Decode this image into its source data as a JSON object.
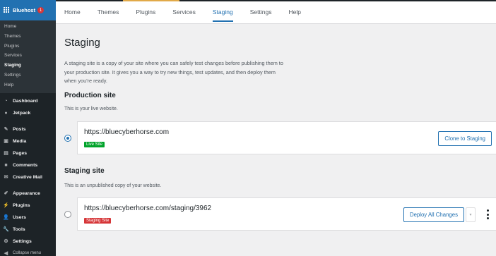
{
  "sidebar": {
    "brand": {
      "label": "Bluehost",
      "badge": "1"
    },
    "sub_items": [
      {
        "label": "Home",
        "active": false
      },
      {
        "label": "Themes",
        "active": false
      },
      {
        "label": "Plugins",
        "active": false
      },
      {
        "label": "Services",
        "active": false
      },
      {
        "label": "Staging",
        "active": true
      },
      {
        "label": "Settings",
        "active": false
      },
      {
        "label": "Help",
        "active": false
      }
    ],
    "items": [
      {
        "label": "Dashboard",
        "icon": "dashboard-icon"
      },
      {
        "label": "Jetpack",
        "icon": "jetpack-icon"
      },
      {
        "label": "Posts",
        "icon": "pin-icon"
      },
      {
        "label": "Media",
        "icon": "media-icon"
      },
      {
        "label": "Pages",
        "icon": "page-icon"
      },
      {
        "label": "Comments",
        "icon": "comment-icon"
      },
      {
        "label": "Creative Mail",
        "icon": "cm-icon"
      },
      {
        "label": "Appearance",
        "icon": "brush-icon"
      },
      {
        "label": "Plugins",
        "icon": "plug-icon"
      },
      {
        "label": "Users",
        "icon": "user-icon"
      },
      {
        "label": "Tools",
        "icon": "wrench-icon"
      },
      {
        "label": "Settings",
        "icon": "settings-icon"
      }
    ],
    "collapse_label": "Collapse menu"
  },
  "tabs": [
    {
      "label": "Home",
      "active": false
    },
    {
      "label": "Themes",
      "active": false
    },
    {
      "label": "Plugins",
      "active": false
    },
    {
      "label": "Services",
      "active": false
    },
    {
      "label": "Staging",
      "active": true
    },
    {
      "label": "Settings",
      "active": false
    },
    {
      "label": "Help",
      "active": false
    }
  ],
  "page": {
    "title": "Staging",
    "intro": "A staging site is a copy of your site where you can safely test changes before publishing them to your production site. It gives you a way to try new things, test updates, and then deploy them when you're ready."
  },
  "production": {
    "heading": "Production site",
    "description": "This is your live website.",
    "url": "https://bluecyberhorse.com",
    "tag": "Live Site",
    "button": "Clone to Staging",
    "selected": true
  },
  "staging": {
    "heading": "Staging site",
    "description": "This is an unpublished copy of your website.",
    "url": "https://bluecyberhorse.com/staging/3962",
    "tag": "Staging Site",
    "button": "Deploy All Changes",
    "selected": false
  },
  "colors": {
    "accent": "#2271b1",
    "sidebar_bg": "#1d2327",
    "live_tag": "#00a32a",
    "staging_tag": "#d63638"
  }
}
